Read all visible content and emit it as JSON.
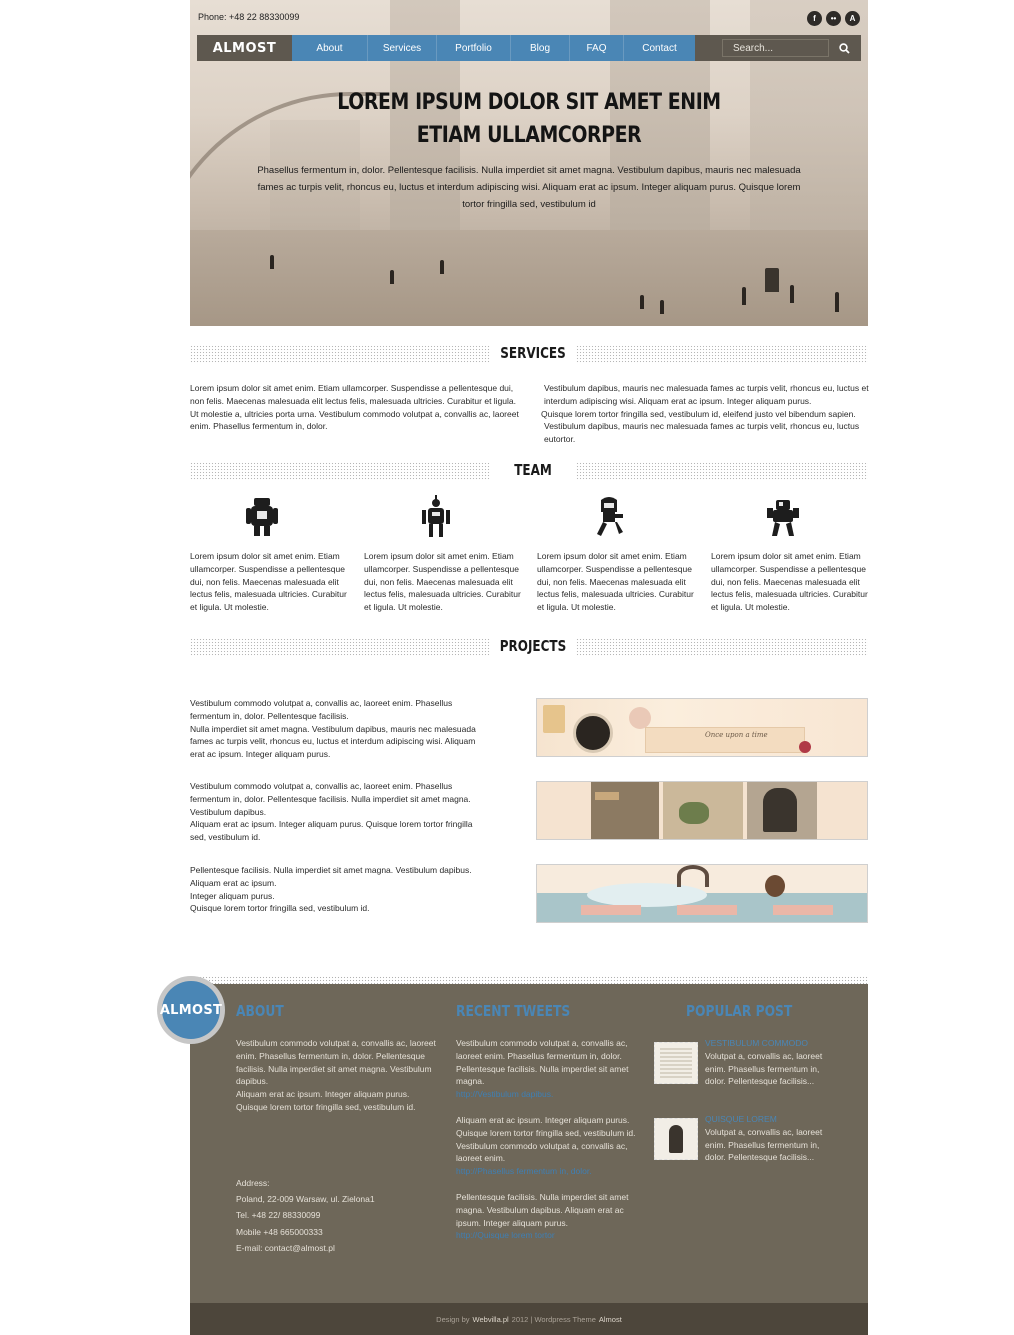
{
  "topbar": {
    "phone": "Phone: +48 22 88330099",
    "social": [
      "f",
      "••",
      "A"
    ]
  },
  "nav": {
    "logo": "ALMOST",
    "items": [
      "About",
      "Services",
      "Portfolio",
      "Blog",
      "FAQ",
      "Contact"
    ],
    "search_placeholder": "Search...",
    "colors": {
      "menu": "#4a86b5",
      "bar": "#5e584f"
    }
  },
  "hero": {
    "title_line1": "LOREM IPSUM DOLOR SIT AMET ENIM",
    "title_line2": "ETIAM ULLAMCORPER",
    "text": "Phasellus fermentum in, dolor. Pellentesque facilisis. Nulla imperdiet sit amet magna. Vestibulum dapibus, mauris nec malesuada fames ac turpis velit, rhoncus eu, luctus et interdum adipiscing wisi. Aliquam erat ac ipsum. Integer aliquam purus. Quisque lorem tortor fringilla sed, vestibulum id"
  },
  "services": {
    "heading": "SERVICES",
    "left": "Lorem ipsum dolor sit amet enim. Etiam ullamcorper. Suspendisse a pellentesque dui, non felis. Maecenas malesuada elit lectus felis, malesuada ultricies. Curabitur et ligula. Ut molestie a, ultricies porta urna. Vestibulum commodo volutpat a, convallis ac, laoreet enim. Phasellus fermentum in, dolor.",
    "right_l1": "Vestibulum dapibus, mauris nec malesuada fames ac turpis velit, rhoncus eu, luctus et interdum adipiscing wisi. Aliquam erat ac ipsum. Integer aliquam purus.",
    "right_l2": "Quisque lorem tortor fringilla sed, vestibulum id, eleifend justo vel bibendum sapien.",
    "right_l3": "Vestibulum dapibus, mauris nec malesuada fames ac turpis velit, rhoncus eu, luctus eutortor."
  },
  "team": {
    "heading": "TEAM",
    "members": [
      {
        "icon": "robot-box-icon",
        "text": "Lorem ipsum dolor sit amet enim. Etiam ullamcorper. Suspendisse a pellentesque dui, non felis. Maecenas malesuada elit lectus felis, malesuada ultricies. Curabitur et ligula. Ut molestie."
      },
      {
        "icon": "robot-antenna-icon",
        "text": "Lorem ipsum dolor sit amet enim. Etiam ullamcorper. Suspendisse a pellentesque dui, non felis. Maecenas malesuada elit lectus felis, malesuada ultricies. Curabitur et ligula. Ut molestie."
      },
      {
        "icon": "robot-walker-icon",
        "text": "Lorem ipsum dolor sit amet enim. Etiam ullamcorper. Suspendisse a pellentesque dui, non felis. Maecenas malesuada elit lectus felis, malesuada ultricies. Curabitur et ligula. Ut molestie."
      },
      {
        "icon": "robot-mech-icon",
        "text": "Lorem ipsum dolor sit amet enim. Etiam ullamcorper. Suspendisse a pellentesque dui, non felis. Maecenas malesuada elit lectus felis, malesuada ultricies. Curabitur et ligula. Ut molestie."
      }
    ]
  },
  "projects": {
    "heading": "PROJECTS",
    "items": [
      {
        "p1": "Vestibulum commodo volutpat a, convallis ac, laoreet enim. Phasellus fermentum in, dolor. Pellentesque facilisis.",
        "p2": "Nulla imperdiet sit amet magna. Vestibulum dapibus, mauris nec malesuada fames ac turpis velit, rhoncus eu, luctus et interdum adipiscing wisi. Aliquam erat ac ipsum. Integer aliquam purus.",
        "image_caption": "Once upon a time"
      },
      {
        "p1": "Vestibulum commodo volutpat a, convallis ac, laoreet enim. Phasellus fermentum in, dolor. Pellentesque facilisis. Nulla imperdiet sit amet magna. Vestibulum dapibus.",
        "p2": "Aliquam erat ac ipsum. Integer aliquam purus. Quisque lorem tortor fringilla sed, vestibulum id.",
        "image_caption": ""
      },
      {
        "p1": "Pellentesque facilisis. Nulla imperdiet sit amet magna. Vestibulum dapibus. Aliquam erat ac ipsum.",
        "p2": "Integer aliquam purus.",
        "p3": "Quisque lorem tortor fringilla sed, vestibulum id.",
        "image_caption": ""
      }
    ]
  },
  "footer": {
    "logo": "ALMOST",
    "about": {
      "heading": "ABOUT",
      "p1": "Vestibulum commodo volutpat a, convallis ac, laoreet enim. Phasellus fermentum in, dolor. Pellentesque facilisis. Nulla imperdiet sit amet magna. Vestibulum dapibus.",
      "p2": "Aliquam erat ac ipsum. Integer aliquam purus. Quisque lorem tortor fringilla sed, vestibulum id.",
      "address_label": "Address:",
      "address": "Poland, 22-009 Warsaw, ul. Zielona1",
      "tel": "Tel. +48 22/ 88330099",
      "mobile": "Mobile +48 665000333",
      "email": "E-mail: contact@almost.pl"
    },
    "tweets": {
      "heading": "RECENT TWEETS",
      "t1": "Vestibulum commodo volutpat a, convallis ac, laoreet enim. Phasellus fermentum in, dolor. Pellentesque facilisis. Nulla imperdiet sit amet magna.",
      "l1": "http://Vestibulum dapibus.",
      "t2": "Aliquam erat ac ipsum. Integer aliquam purus. Quisque lorem tortor fringilla sed, vestibulum id.",
      "t2b": "Vestibulum commodo volutpat a, convallis ac, laoreet enim.",
      "l2": "http://Phasellus fermentum in, dolor.",
      "t3": "Pellentesque facilisis. Nulla imperdiet sit amet magna. Vestibulum dapibus. Aliquam erat ac ipsum. Integer aliquam purus.",
      "l3": "http://Quisque lorem tortor"
    },
    "popular": {
      "heading": "POPULAR POST",
      "posts": [
        {
          "title": "VESTIBULUM COMMODO",
          "text": "Volutpat a, convallis ac, laoreet enim. Phasellus fermentum in, dolor. Pellentesque facilisis..."
        },
        {
          "title": "QUISQUE LOREM",
          "text": "Volutpat a, convallis ac, laoreet enim. Phasellus fermentum in, dolor. Pellentesque facilisis..."
        }
      ]
    },
    "credit": {
      "prefix": "Design by",
      "brand": "Webvilla.pl",
      "year": "2012 | Wordpress Theme",
      "theme": "Almost"
    }
  }
}
